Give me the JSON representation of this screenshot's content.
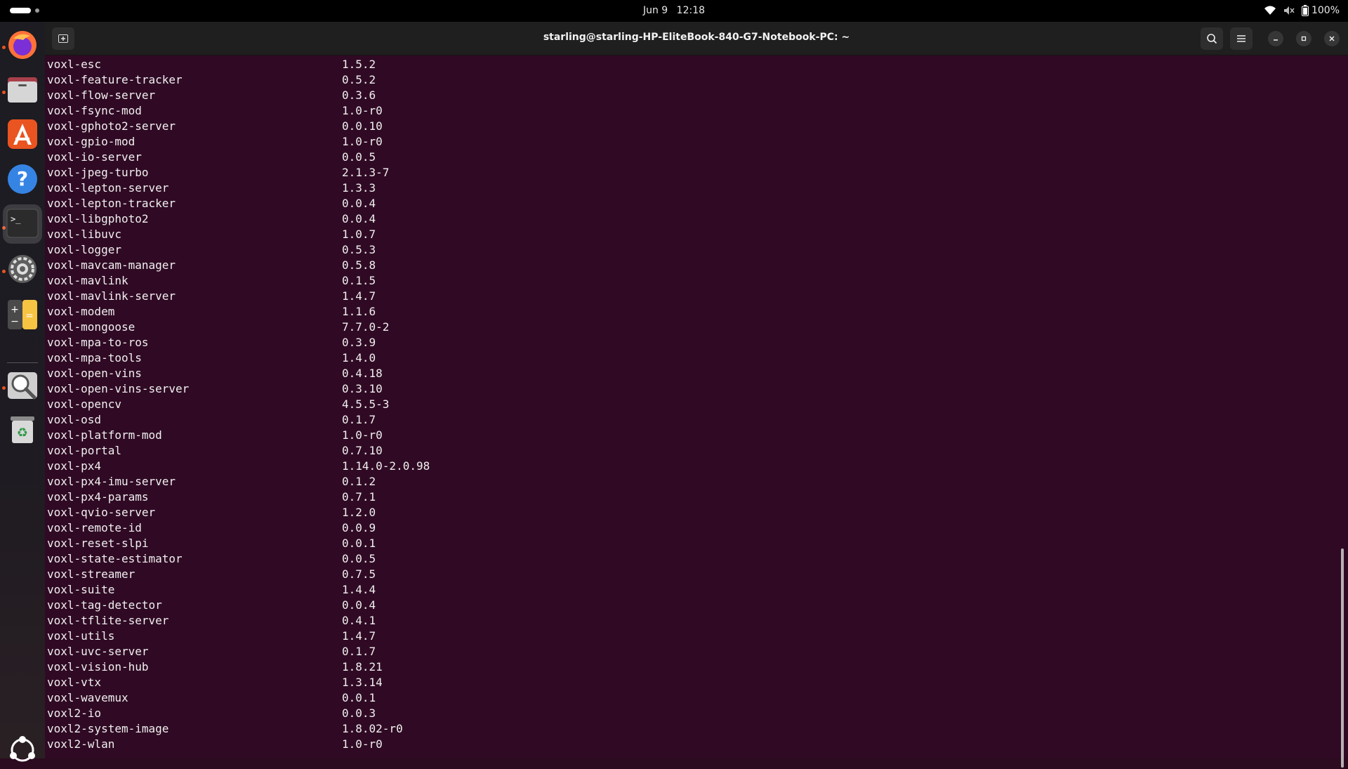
{
  "topbar": {
    "date": "Jun 9",
    "time": "12:18",
    "battery": "100%"
  },
  "dock": {
    "items": [
      {
        "name": "firefox-icon",
        "running": true
      },
      {
        "name": "files-icon",
        "running": true
      },
      {
        "name": "app-center-icon",
        "running": false
      },
      {
        "name": "help-icon",
        "running": false
      },
      {
        "name": "terminal-icon",
        "running": true,
        "active": true
      },
      {
        "name": "settings-icon",
        "running": true
      },
      {
        "name": "calculator-icon",
        "running": false
      },
      {
        "name": "image-viewer-icon",
        "running": true
      },
      {
        "name": "trash-icon",
        "running": false
      },
      {
        "name": "show-apps-icon",
        "running": false
      }
    ]
  },
  "window": {
    "title": "starling@starling-HP-EliteBook-840-G7-Notebook-PC: ~"
  },
  "terminal": {
    "rows": [
      {
        "package": "voxl-esc",
        "version": "1.5.2"
      },
      {
        "package": "voxl-feature-tracker",
        "version": "0.5.2"
      },
      {
        "package": "voxl-flow-server",
        "version": "0.3.6"
      },
      {
        "package": "voxl-fsync-mod",
        "version": "1.0-r0"
      },
      {
        "package": "voxl-gphoto2-server",
        "version": "0.0.10"
      },
      {
        "package": "voxl-gpio-mod",
        "version": "1.0-r0"
      },
      {
        "package": "voxl-io-server",
        "version": "0.0.5"
      },
      {
        "package": "voxl-jpeg-turbo",
        "version": "2.1.3-7"
      },
      {
        "package": "voxl-lepton-server",
        "version": "1.3.3"
      },
      {
        "package": "voxl-lepton-tracker",
        "version": "0.0.4"
      },
      {
        "package": "voxl-libgphoto2",
        "version": "0.0.4"
      },
      {
        "package": "voxl-libuvc",
        "version": "1.0.7"
      },
      {
        "package": "voxl-logger",
        "version": "0.5.3"
      },
      {
        "package": "voxl-mavcam-manager",
        "version": "0.5.8"
      },
      {
        "package": "voxl-mavlink",
        "version": "0.1.5"
      },
      {
        "package": "voxl-mavlink-server",
        "version": "1.4.7"
      },
      {
        "package": "voxl-modem",
        "version": "1.1.6"
      },
      {
        "package": "voxl-mongoose",
        "version": "7.7.0-2"
      },
      {
        "package": "voxl-mpa-to-ros",
        "version": "0.3.9"
      },
      {
        "package": "voxl-mpa-tools",
        "version": "1.4.0"
      },
      {
        "package": "voxl-open-vins",
        "version": "0.4.18"
      },
      {
        "package": "voxl-open-vins-server",
        "version": "0.3.10"
      },
      {
        "package": "voxl-opencv",
        "version": "4.5.5-3"
      },
      {
        "package": "voxl-osd",
        "version": "0.1.7"
      },
      {
        "package": "voxl-platform-mod",
        "version": "1.0-r0"
      },
      {
        "package": "voxl-portal",
        "version": "0.7.10"
      },
      {
        "package": "voxl-px4",
        "version": "1.14.0-2.0.98"
      },
      {
        "package": "voxl-px4-imu-server",
        "version": "0.1.2"
      },
      {
        "package": "voxl-px4-params",
        "version": "0.7.1"
      },
      {
        "package": "voxl-qvio-server",
        "version": "1.2.0"
      },
      {
        "package": "voxl-remote-id",
        "version": "0.0.9"
      },
      {
        "package": "voxl-reset-slpi",
        "version": "0.0.1"
      },
      {
        "package": "voxl-state-estimator",
        "version": "0.0.5"
      },
      {
        "package": "voxl-streamer",
        "version": "0.7.5"
      },
      {
        "package": "voxl-suite",
        "version": "1.4.4"
      },
      {
        "package": "voxl-tag-detector",
        "version": "0.0.4"
      },
      {
        "package": "voxl-tflite-server",
        "version": "0.4.1"
      },
      {
        "package": "voxl-utils",
        "version": "1.4.7"
      },
      {
        "package": "voxl-uvc-server",
        "version": "0.1.7"
      },
      {
        "package": "voxl-vision-hub",
        "version": "1.8.21"
      },
      {
        "package": "voxl-vtx",
        "version": "1.3.14"
      },
      {
        "package": "voxl-wavemux",
        "version": "0.0.1"
      },
      {
        "package": "voxl2-io",
        "version": "0.0.3"
      },
      {
        "package": "voxl2-system-image",
        "version": "1.8.02-r0"
      },
      {
        "package": "voxl2-wlan",
        "version": "1.0-r0"
      }
    ]
  },
  "colors": {
    "terminal_bg": "#300a24",
    "accent": "#e95420"
  }
}
